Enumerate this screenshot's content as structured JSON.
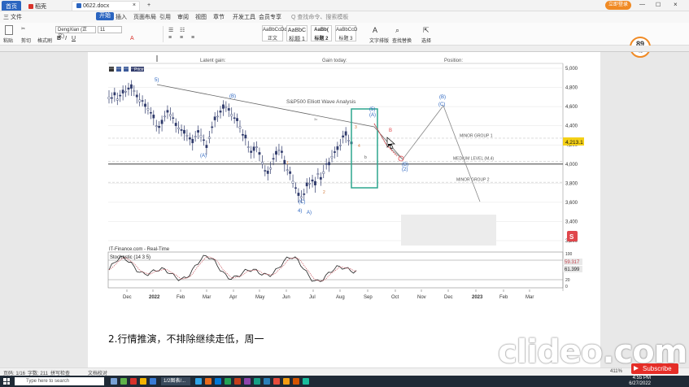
{
  "titlebar": {
    "tabs": [
      "首页",
      "稻壳",
      "0622.docx"
    ],
    "login": "立即登录"
  },
  "menubar": {
    "items": [
      "三 文件",
      "开始",
      "插入",
      "页面布局",
      "引用",
      "审阅",
      "视图",
      "章节",
      "开发工具",
      "会员专享"
    ],
    "search_placeholder": "Q 查找命令、搜索模板"
  },
  "toolbar": {
    "paste": "粘贴",
    "cut": "剪切",
    "format_painter": "格式刷",
    "font_name": "DengXian (正文)",
    "font_size": "11",
    "styles": [
      {
        "preview": "AaBbCcDd",
        "name": "正文"
      },
      {
        "preview": "AaBbC",
        "name": "标题 1"
      },
      {
        "preview": "AaBb(",
        "name": "标题 2"
      },
      {
        "preview": "AaBbCcD",
        "name": "标题 3"
      }
    ],
    "text_tools": "文字排版",
    "find_replace": "查找替换",
    "select": "选择"
  },
  "zoom_badge": {
    "value": "89",
    "unit": "%"
  },
  "chart_header": {
    "latent_gain": "Latent gain:",
    "gain_today": "Gain today:",
    "position": "Position:",
    "price_legend": "Price"
  },
  "chart_data": {
    "type": "line",
    "title": "S&P500 Elliott Wave Analysis",
    "x_ticks": [
      "Dec",
      "2022",
      "Feb",
      "Mar",
      "Apr",
      "May",
      "Jun",
      "Jul",
      "Aug",
      "Sep",
      "Oct",
      "Nov",
      "Dec",
      "2023",
      "Feb",
      "Mar"
    ],
    "y_ticks": [
      5000,
      4800,
      4600,
      4400,
      4200,
      4000,
      3800,
      3600,
      3400,
      3200
    ],
    "ylim": [
      3200,
      5000
    ],
    "price_marker": "4,213.1",
    "medium_level_value": 4000,
    "levels": [
      {
        "label": "MINOR GROUP 1",
        "value": 4270
      },
      {
        "label": "MEDIUM LEVEL (M,4)",
        "value": 4030
      },
      {
        "label": "MINOR GROUP 2",
        "value": 3810
      }
    ],
    "wave_labels": [
      "5)",
      "(B)",
      "(A)",
      "(C)",
      "4)",
      "A)",
      "(5)",
      "(A)",
      "(B)",
      "(2)",
      "(B)",
      "(C)",
      "C)",
      "II (IV)"
    ],
    "source": "IT-Finance.com - Real-Time",
    "stochastic": {
      "label": "Stochastic (14 3 5)",
      "y_ticks": [
        100,
        80,
        50,
        20,
        0
      ],
      "value_a": "59.317",
      "value_b": "61.399"
    }
  },
  "document": {
    "paragraph": "2.行情推演，不排除继续走低，周一"
  },
  "statusbar": {
    "page": "页码: 1/16",
    "words": "字数: 211",
    "spell": "拼写检查",
    "doc_check": "文档校对",
    "zoom": "411%"
  },
  "taskbar": {
    "search_placeholder": "Type here to search",
    "time": "4:55 PM",
    "date": "6/27/2022"
  },
  "overlay": {
    "watermark": "clideo.com",
    "subscribe": "Subscribe"
  },
  "colors": {
    "accent": "#2b65c0",
    "wps_red": "#d8322a",
    "teal_box": "#2ca58d",
    "red_arrow": "#e0474c",
    "candles": "#2f3a6b"
  }
}
